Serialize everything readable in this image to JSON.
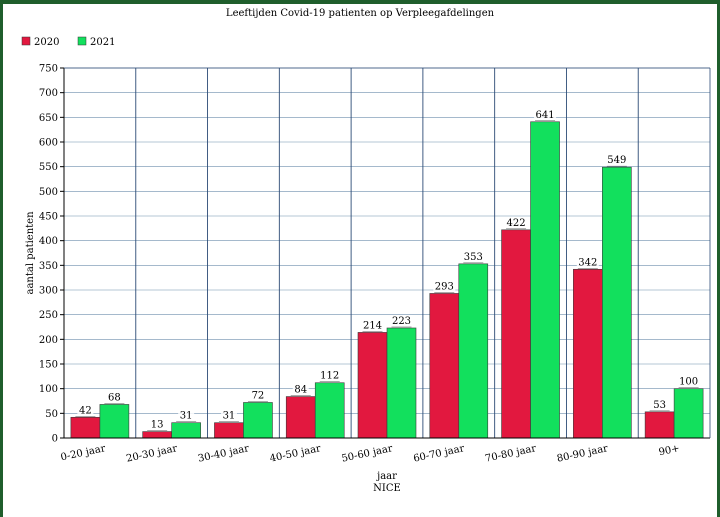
{
  "chart_data": {
    "type": "bar",
    "title": "Leeftijden Covid-19 patienten op Verpleegafdelingen",
    "xlabel": "jaar",
    "xlabel2": "NICE",
    "ylabel": "aantal patienten",
    "ylim": [
      0,
      750
    ],
    "yticks": [
      0,
      50,
      100,
      150,
      200,
      250,
      300,
      350,
      400,
      450,
      500,
      550,
      600,
      650,
      700,
      750
    ],
    "grid": true,
    "legend_position": "top-left",
    "categories": [
      "0-20 jaar",
      "20-30 jaar",
      "30-40 jaar",
      "40-50 jaar",
      "50-60 jaar",
      "60-70 jaar",
      "70-80 jaar",
      "80-90 jaar",
      "90+"
    ],
    "series": [
      {
        "name": "2020",
        "color": "#e2183f",
        "values": [
          42,
          13,
          31,
          84,
          214,
          293,
          422,
          342,
          53
        ]
      },
      {
        "name": "2021",
        "color": "#12e05d",
        "values": [
          68,
          31,
          72,
          112,
          223,
          353,
          641,
          549,
          100
        ]
      }
    ]
  }
}
